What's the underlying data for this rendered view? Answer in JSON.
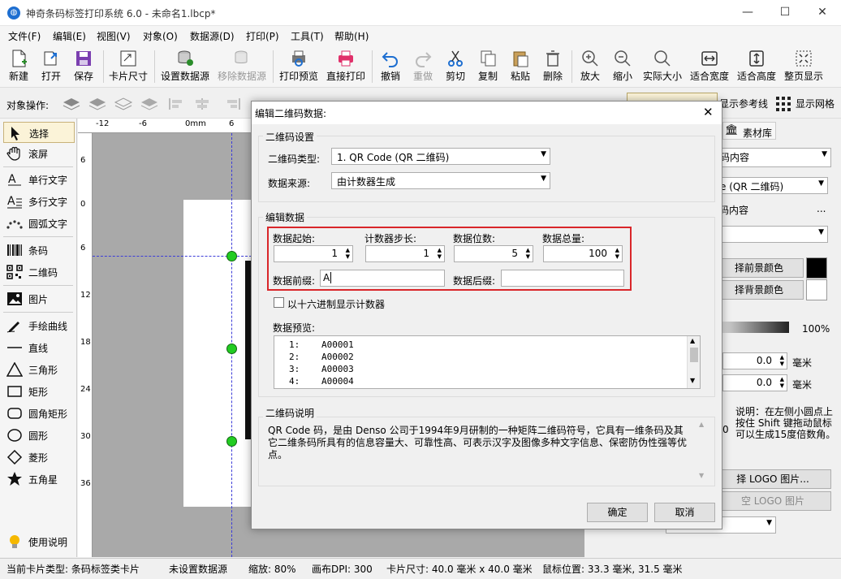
{
  "window": {
    "title": "神奇条码标签打印系统 6.0 - 未命名1.lbcp*",
    "icon_glyph": "◍"
  },
  "menu": [
    "文件(F)",
    "编辑(E)",
    "视图(V)",
    "对象(O)",
    "数据源(D)",
    "打印(P)",
    "工具(T)",
    "帮助(H)"
  ],
  "toolbar": {
    "new": "新建",
    "open": "打开",
    "save": "保存",
    "card_size": "卡片尺寸",
    "set_datasource": "设置数据源",
    "remove_datasource": "移除数据源",
    "print_preview": "打印预览",
    "direct_print": "直接打印",
    "undo": "撤销",
    "redo": "重做",
    "cut": "剪切",
    "copy": "复制",
    "paste": "粘贴",
    "delete": "删除",
    "zoom_in": "放大",
    "zoom_out": "缩小",
    "actual_size": "实际大小",
    "fit_width": "适合宽度",
    "fit_height": "适合高度",
    "fit_page": "整页显示"
  },
  "objbar": {
    "label": "对象操作:",
    "show_guides": "显示参考线",
    "show_grid": "显示网格"
  },
  "left_tools": {
    "select": "选择",
    "scroll": "滚屏",
    "single_text": "单行文字",
    "multi_text": "多行文字",
    "arc_text": "圆弧文字",
    "barcode": "条码",
    "qrcode": "二维码",
    "image": "图片",
    "freehand": "手绘曲线",
    "line": "直线",
    "triangle": "三角形",
    "rect": "矩形",
    "round_rect": "圆角矩形",
    "ellipse": "圆形",
    "diamond": "菱形",
    "star": "五角星",
    "help": "使用说明"
  },
  "ruler": {
    "top": [
      "-12",
      "-6",
      "0mm",
      "6"
    ],
    "left": [
      "6",
      "0",
      "6",
      "12",
      "18",
      "24",
      "30",
      "36"
    ]
  },
  "right_panel": {
    "tab_library": "素材库",
    "content_select": "码内容",
    "qr_type_partial": "e (QR 二维码)",
    "content_label": "码内容",
    "more_btn": "...",
    "fg_color_btn": "择前景颜色",
    "bg_color_btn": "择背景颜色",
    "opacity": "100%",
    "val1": "0.0",
    "unit1": "毫米",
    "val2": "0.0",
    "unit2": "毫米",
    "hint": "说明：在左侧小圆点上按住 Shift 键拖动鼠标可以生成15度倍数角。",
    "digit_zero": "0",
    "logo_btn": "择 LOGO 图片...",
    "clear_logo_btn": "空 LOGO 图片",
    "fg_color": "#000000",
    "bg_color": "#ffffff"
  },
  "dialog": {
    "title": "编辑二维码数据:",
    "qr_settings": "二维码设置",
    "qr_type_label": "二维码类型:",
    "qr_type_value": "1. QR Code (QR 二维码)",
    "source_label": "数据来源:",
    "source_value": "由计数器生成",
    "edit_data": "编辑数据",
    "start_label": "数据起始:",
    "start_value": "1",
    "step_label": "计数器步长:",
    "step_value": "1",
    "digits_label": "数据位数:",
    "digits_value": "5",
    "total_label": "数据总量:",
    "total_value": "100",
    "prefix_label": "数据前缀:",
    "prefix_value": "A",
    "suffix_label": "数据后缀:",
    "suffix_value": "",
    "hex_label": "以十六进制显示计数器",
    "preview_label": "数据预览:",
    "preview_rows": [
      {
        "n": "1:",
        "v": "A00001"
      },
      {
        "n": "2:",
        "v": "A00002"
      },
      {
        "n": "3:",
        "v": "A00003"
      },
      {
        "n": "4:",
        "v": "A00004"
      }
    ],
    "desc_title": "二维码说明",
    "desc_text": "QR Code 码，是由 Denso 公司于1994年9月研制的一种矩阵二维码符号，它具有一维条码及其它二维条码所具有的信息容量大、可靠性高、可表示汉字及图像多种文字信息、保密防伪性强等优点。",
    "ok": "确定",
    "cancel": "取消",
    "close": "✕",
    "highlight_color": "#d9262a"
  },
  "status": {
    "card_type": "当前卡片类型: 条码标签类卡片",
    "datasource": "未设置数据源",
    "zoom": "缩放: 80%",
    "dpi": "画布DPI: 300",
    "card_size": "卡片尺寸: 40.0 毫米 x 40.0 毫米",
    "mouse": "鼠标位置: 33.3 毫米, 31.5 毫米"
  }
}
